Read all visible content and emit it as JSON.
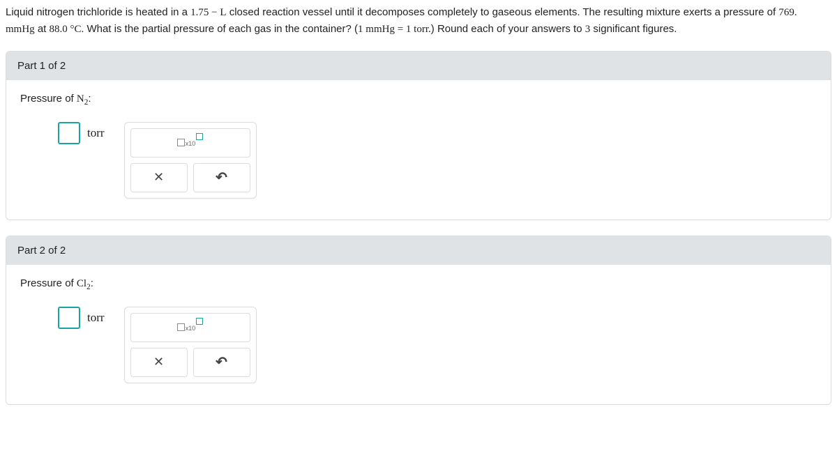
{
  "question": {
    "pre1": "Liquid nitrogen trichloride is heated in a ",
    "vol": "1.75 − L",
    "post1": " closed reaction vessel until it decomposes completely to gaseous elements. The resulting mixture exerts a pressure of ",
    "pressure": "769. mmHg",
    "post2": " at ",
    "temp": "88.0 °C.",
    "post3": " What is the partial pressure of each gas in the container? ",
    "conversion_open": "(",
    "conv_left": "1 mmHg",
    "conv_eq": " = ",
    "conv_right": "1 torr.",
    "conversion_close": ")",
    "post4": " Round each of your answers to ",
    "sigfigs": "3",
    "post5": " significant figures."
  },
  "parts": [
    {
      "header": "Part 1 of 2",
      "prompt_prefix": "Pressure of ",
      "prompt_species_base": "N",
      "prompt_species_sub": "2",
      "prompt_suffix": ":",
      "unit": "torr"
    },
    {
      "header": "Part 2 of 2",
      "prompt_prefix": "Pressure of ",
      "prompt_species_base": "Cl",
      "prompt_species_sub": "2",
      "prompt_suffix": ":",
      "unit": "torr"
    }
  ],
  "tools": {
    "sci_x10": "x10",
    "clear_symbol": "✕",
    "undo_symbol": "↶"
  }
}
